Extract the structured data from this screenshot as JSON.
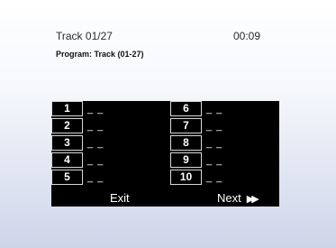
{
  "header": {
    "track": "Track 01/27",
    "time": "00:09",
    "program": "Program: Track (01-27)"
  },
  "slots_left": [
    {
      "num": "1",
      "value": "_ _"
    },
    {
      "num": "2",
      "value": "_ _"
    },
    {
      "num": "3",
      "value": "_ _"
    },
    {
      "num": "4",
      "value": "_ _"
    },
    {
      "num": "5",
      "value": "_ _"
    }
  ],
  "slots_right": [
    {
      "num": "6",
      "value": "_ _"
    },
    {
      "num": "7",
      "value": "_ _"
    },
    {
      "num": "8",
      "value": "_ _"
    },
    {
      "num": "9",
      "value": "_ _"
    },
    {
      "num": "10",
      "value": "_ _"
    }
  ],
  "buttons": {
    "exit": "Exit",
    "next": "Next",
    "next_icon": "fast-forward-icon",
    "next_glyph": "▶▶"
  }
}
